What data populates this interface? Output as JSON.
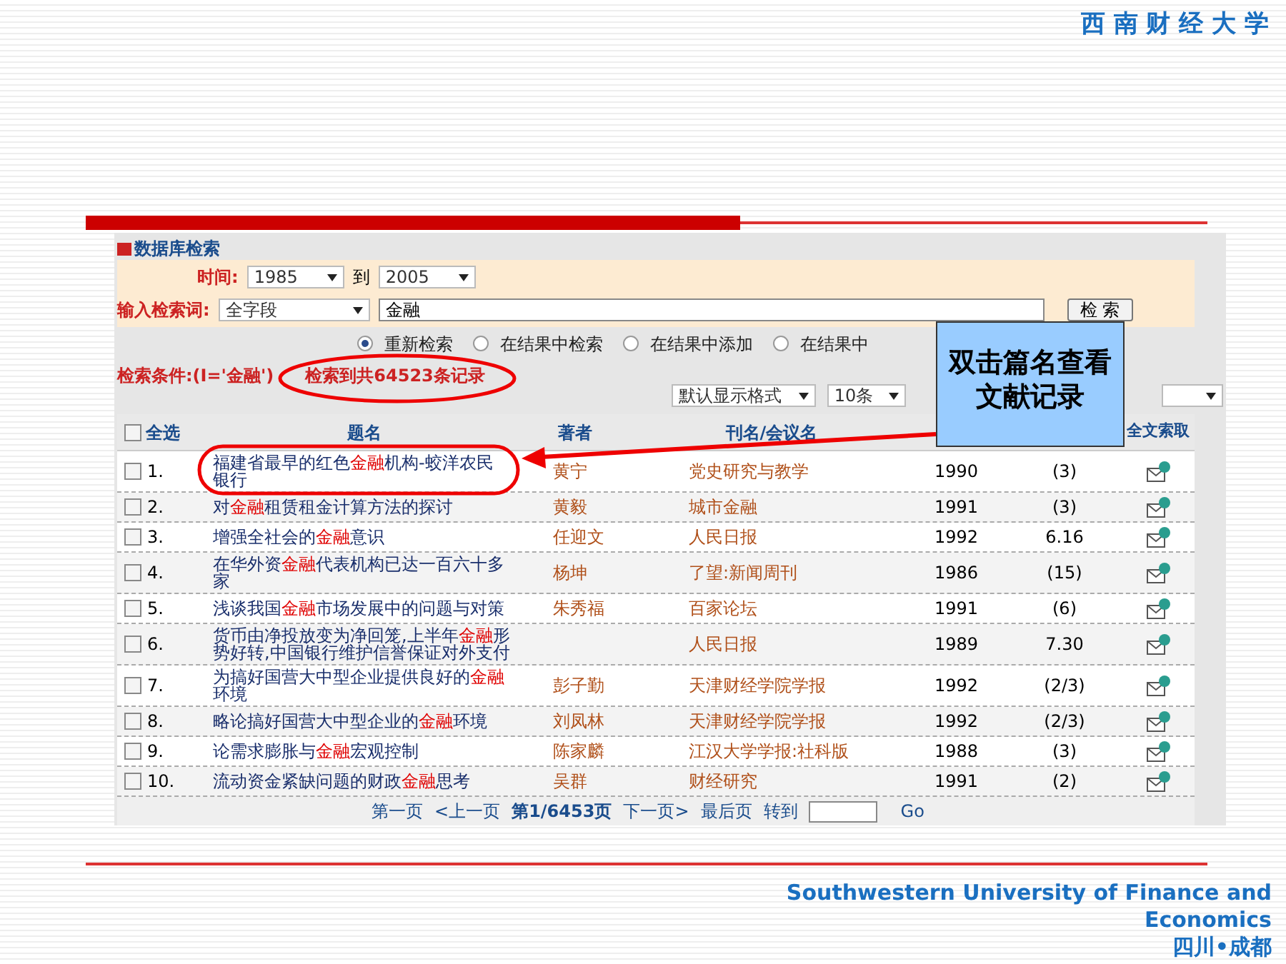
{
  "header_title": "西 南 财 经 大 学",
  "panel": {
    "title": "数据库检索",
    "time_label": "时间:",
    "year_from": "1985",
    "to_label": "到",
    "year_to": "2005",
    "keyword_label": "输入检索词:",
    "field": "全字段",
    "keyword": "金融",
    "search_button": "检 索",
    "modes": [
      {
        "label": "重新检索",
        "selected": true
      },
      {
        "label": "在结果中检索",
        "selected": false
      },
      {
        "label": "在结果中添加",
        "selected": false
      },
      {
        "label": "在结果中",
        "selected": false
      }
    ],
    "condition": "检索条件:(I='金融')",
    "result_count": "检索到共64523条记录",
    "format": "默认显示格式",
    "page_size": "10条"
  },
  "table": {
    "select_all": {
      "label": "全选",
      "checked": false
    },
    "columns": [
      "题名",
      "著者",
      "刊名/会议名",
      "全文索取"
    ],
    "rows": [
      {
        "number": "1.",
        "checked": false,
        "title": [
          {
            "text": "福建省最早的红色",
            "hit": false
          },
          {
            "text": "金融",
            "hit": true
          },
          {
            "text": "机构-蛟洋农民银行",
            "hit": false
          }
        ],
        "author": "黄宁",
        "source": "党史研究与教学",
        "year": "1990",
        "issue": "(3)"
      },
      {
        "number": "2.",
        "checked": false,
        "title": [
          {
            "text": "对",
            "hit": false
          },
          {
            "text": "金融",
            "hit": true
          },
          {
            "text": "租赁租金计算方法的探讨",
            "hit": false
          }
        ],
        "author": "黄毅",
        "source": "城市金融",
        "year": "1991",
        "issue": "(3)"
      },
      {
        "number": "3.",
        "checked": false,
        "title": [
          {
            "text": "增强全社会的",
            "hit": false
          },
          {
            "text": "金融",
            "hit": true
          },
          {
            "text": "意识",
            "hit": false
          }
        ],
        "author": "任迎文",
        "source": "人民日报",
        "year": "1992",
        "issue": "6.16"
      },
      {
        "number": "4.",
        "checked": false,
        "title": [
          {
            "text": "在华外资",
            "hit": false
          },
          {
            "text": "金融",
            "hit": true
          },
          {
            "text": "代表机构已达一百六十多家",
            "hit": false
          }
        ],
        "author": "杨坤",
        "source": "了望:新闻周刊",
        "year": "1986",
        "issue": "(15)"
      },
      {
        "number": "5.",
        "checked": false,
        "title": [
          {
            "text": "浅谈我国",
            "hit": false
          },
          {
            "text": "金融",
            "hit": true
          },
          {
            "text": "市场发展中的问题与对策",
            "hit": false
          }
        ],
        "author": "朱秀福",
        "source": "百家论坛",
        "year": "1991",
        "issue": "(6)"
      },
      {
        "number": "6.",
        "checked": false,
        "title": [
          {
            "text": "货币由净投放变为净回笼,上半年",
            "hit": false
          },
          {
            "text": "金融",
            "hit": true
          },
          {
            "text": "形势好转,中国银行维护信誉保证对外支付",
            "hit": false
          }
        ],
        "source": "人民日报",
        "year": "1989",
        "issue": "7.30"
      },
      {
        "number": "7.",
        "checked": false,
        "title": [
          {
            "text": "为搞好国营大中型企业提供良好的",
            "hit": false
          },
          {
            "text": "金融",
            "hit": true
          },
          {
            "text": "环境",
            "hit": false
          }
        ],
        "author": "彭子勤",
        "source": "天津财经学院学报",
        "year": "1992",
        "issue": "(2/3)"
      },
      {
        "number": "8.",
        "checked": false,
        "title": [
          {
            "text": "略论搞好国营大中型企业的",
            "hit": false
          },
          {
            "text": "金融",
            "hit": true
          },
          {
            "text": "环境",
            "hit": false
          }
        ],
        "author": "刘凤林",
        "source": "天津财经学院学报",
        "year": "1992",
        "issue": "(2/3)"
      },
      {
        "number": "9.",
        "checked": false,
        "title": [
          {
            "text": "论需求膨胀与",
            "hit": false
          },
          {
            "text": "金融",
            "hit": true
          },
          {
            "text": "宏观控制",
            "hit": false
          }
        ],
        "author": "陈家麟",
        "source": "江汉大学学报:社科版",
        "year": "1988",
        "issue": "(3)"
      },
      {
        "number": "10.",
        "checked": false,
        "title": [
          {
            "text": "流动资金紧缺问题的财政",
            "hit": false
          },
          {
            "text": "金融",
            "hit": true
          },
          {
            "text": "思考",
            "hit": false
          }
        ],
        "author": "吴群",
        "source": "财经研究",
        "year": "1991",
        "issue": "(2)"
      }
    ]
  },
  "pagination": {
    "first": "第一页",
    "prev": "<上一页",
    "current": "第1/6453页",
    "next": "下一页>",
    "last": "最后页",
    "goto_label": "转到",
    "go": "Go"
  },
  "callout": {
    "lines": [
      "双击篇名查看",
      "文献记录"
    ]
  },
  "footer": {
    "lines": [
      "Southwestern University of Finance and",
      "Economics",
      "四川•成都"
    ]
  }
}
